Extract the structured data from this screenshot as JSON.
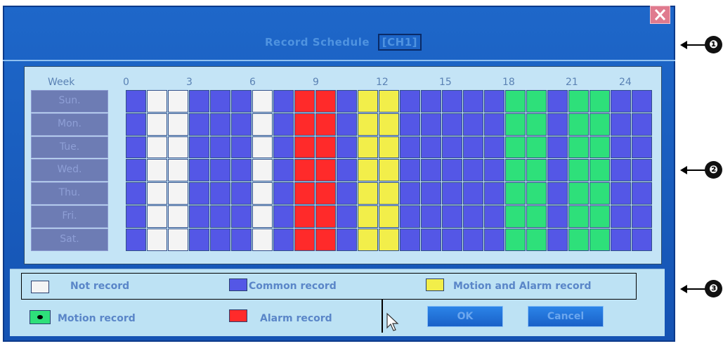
{
  "dialog": {
    "title": "Record Schedule",
    "channel": "[CH1]"
  },
  "schedule": {
    "week_label": "Week",
    "hour_labels": [
      "0",
      "3",
      "6",
      "9",
      "12",
      "15",
      "18",
      "21",
      "24"
    ],
    "days": [
      "Sun.",
      "Mon.",
      "Tue.",
      "Wed.",
      "Thu.",
      "Fri.",
      "Sat."
    ],
    "slot_colors": {
      "not_record": "#f4f4f4",
      "common_record": "#5457e6",
      "alarm_record": "#ff2a2a",
      "motion_alarm_record": "#f2ee4a",
      "motion_record": "#2ee07a"
    },
    "hour_modes": [
      "common",
      "not",
      "not",
      "common",
      "common",
      "common",
      "not",
      "common",
      "alarm",
      "alarm",
      "common",
      "motion_alarm",
      "motion_alarm",
      "common",
      "common",
      "common",
      "common",
      "common",
      "motion",
      "motion",
      "common",
      "motion",
      "motion",
      "common",
      "common"
    ]
  },
  "legend": {
    "not_record": "Not record",
    "common_record": "Common record",
    "motion_alarm_record": "Motion and Alarm record",
    "motion_record": "Motion record",
    "alarm_record": "Alarm record"
  },
  "buttons": {
    "ok": "OK",
    "cancel": "Cancel"
  },
  "callouts": [
    "❶",
    "❷",
    "❸"
  ]
}
